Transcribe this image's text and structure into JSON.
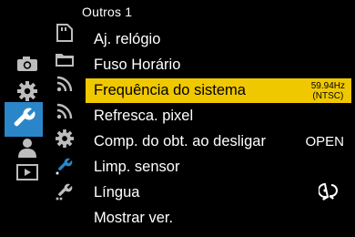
{
  "header": {
    "title": "Outros 1"
  },
  "colors": {
    "selected_row": "#f0c800",
    "active_tab": "#2a86c8",
    "icon_gray": "#bdbdbd"
  },
  "tabs": [
    {
      "icon": "camera-icon"
    },
    {
      "icon": "gear-icon"
    },
    {
      "icon": "wrench-icon",
      "active": true
    },
    {
      "icon": "person-icon"
    },
    {
      "icon": "playback-icon"
    }
  ],
  "subtabs": [
    {
      "icon": "card-setup-icon"
    },
    {
      "icon": "folder-icon"
    },
    {
      "icon": "wireless-icon"
    },
    {
      "icon": "wireless-2-icon"
    },
    {
      "icon": "gear-sub-icon"
    },
    {
      "icon": "wrench-sub-1-icon",
      "active": true
    },
    {
      "icon": "wrench-sub-2-icon"
    }
  ],
  "menu": {
    "items": [
      {
        "label": "Aj. relógio",
        "value": ""
      },
      {
        "label": "Fuso Horário",
        "value": ""
      },
      {
        "label": "Frequência do sistema",
        "value": "59.94Hz",
        "value2": "(NTSC)",
        "selected": true
      },
      {
        "label": "Refresca. pixel",
        "value": ""
      },
      {
        "label": "Comp. do obt. ao desligar",
        "value": "OPEN"
      },
      {
        "label": "Limp. sensor",
        "value": ""
      },
      {
        "label": "Língua",
        "value": "",
        "value_icon": "language-icon"
      },
      {
        "label": "Mostrar ver.",
        "value": ""
      }
    ]
  }
}
